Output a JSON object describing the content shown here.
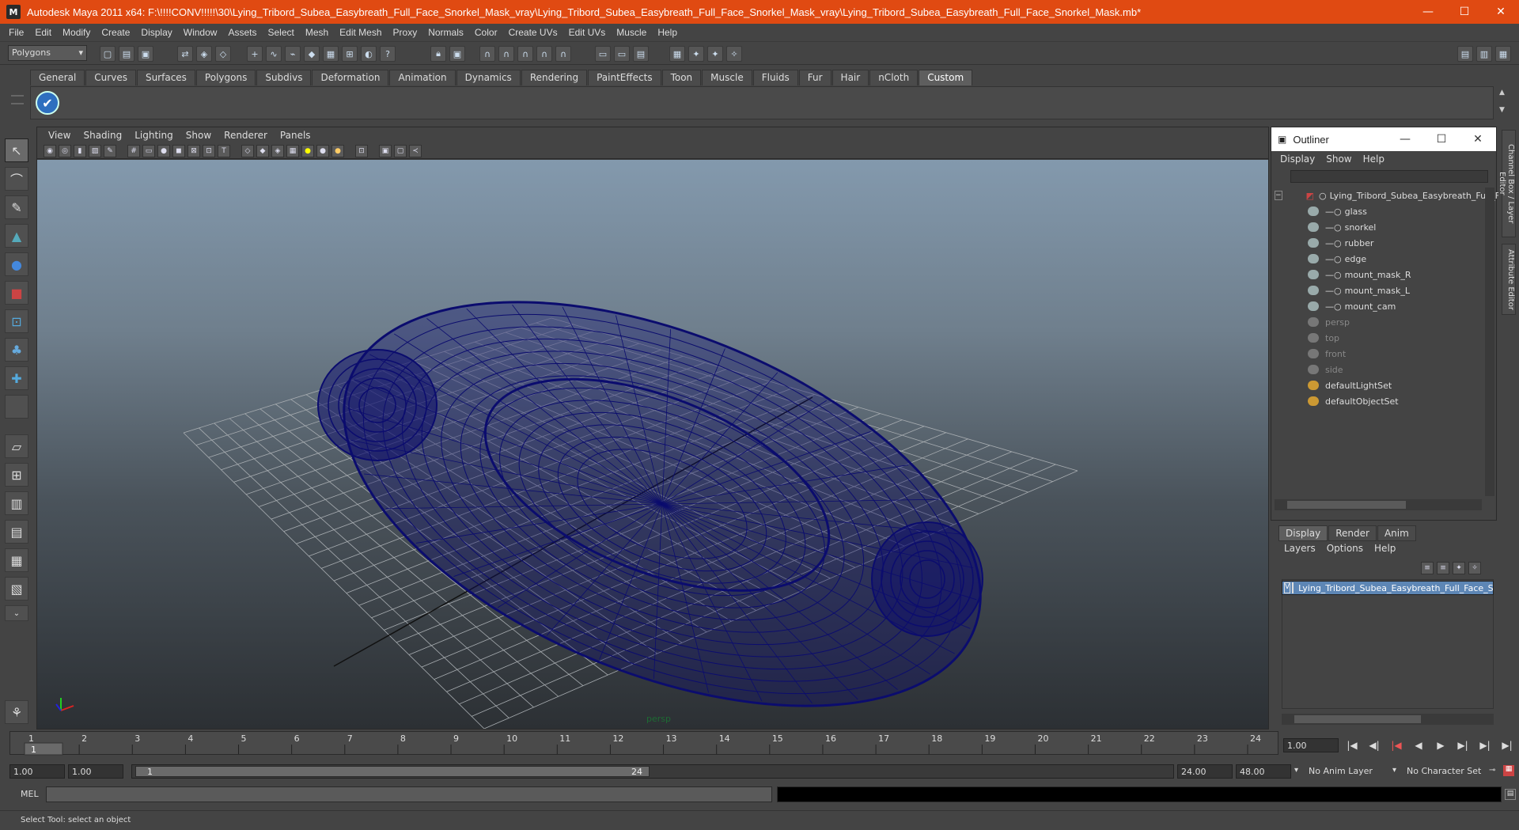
{
  "window": {
    "title": "Autodesk Maya 2011 x64: F:\\!!!!CONV!!!!!\\30\\Lying_Tribord_Subea_Easybreath_Full_Face_Snorkel_Mask_vray\\Lying_Tribord_Subea_Easybreath_Full_Face_Snorkel_Mask_vray\\Lying_Tribord_Subea_Easybreath_Full_Face_Snorkel_Mask.mb*",
    "minimize": "—",
    "maximize": "☐",
    "close": "✕"
  },
  "menubar": [
    "File",
    "Edit",
    "Modify",
    "Create",
    "Display",
    "Window",
    "Assets",
    "Select",
    "Mesh",
    "Edit Mesh",
    "Proxy",
    "Normals",
    "Color",
    "Create UVs",
    "Edit UVs",
    "Muscle",
    "Help"
  ],
  "statusline": {
    "mode": "Polygons"
  },
  "shelf": {
    "tabs": [
      "General",
      "Curves",
      "Surfaces",
      "Polygons",
      "Subdivs",
      "Deformation",
      "Animation",
      "Dynamics",
      "Rendering",
      "PaintEffects",
      "Toon",
      "Muscle",
      "Fluids",
      "Fur",
      "Hair",
      "nCloth",
      "Custom"
    ],
    "active_tab": "Custom"
  },
  "viewport": {
    "menu": [
      "View",
      "Shading",
      "Lighting",
      "Show",
      "Renderer",
      "Panels"
    ],
    "camera": "persp",
    "wire_color": "#0b0c6e"
  },
  "outliner": {
    "title": "Outliner",
    "menu": [
      "Display",
      "Show",
      "Help"
    ],
    "items": [
      {
        "label": "Lying_Tribord_Subea_Easybreath_Full_F",
        "dim": false
      },
      {
        "label": "glass",
        "dim": false
      },
      {
        "label": "snorkel",
        "dim": false
      },
      {
        "label": "rubber",
        "dim": false
      },
      {
        "label": "edge",
        "dim": false
      },
      {
        "label": "mount_mask_R",
        "dim": false
      },
      {
        "label": "mount_mask_L",
        "dim": false
      },
      {
        "label": "mount_cam",
        "dim": false
      },
      {
        "label": "persp",
        "dim": true
      },
      {
        "label": "top",
        "dim": true
      },
      {
        "label": "front",
        "dim": true
      },
      {
        "label": "side",
        "dim": true
      },
      {
        "label": "defaultLightSet",
        "dim": false
      },
      {
        "label": "defaultObjectSet",
        "dim": false
      }
    ]
  },
  "layer_editor": {
    "tabs": [
      "Display",
      "Render",
      "Anim"
    ],
    "menu": [
      "Layers",
      "Options",
      "Help"
    ],
    "layer_name": "Lying_Tribord_Subea_Easybreath_Full_Face_Sn",
    "layer_flag": "V"
  },
  "side_tabs": [
    "Channel Box / Layer Editor",
    "Attribute Editor"
  ],
  "timeline": {
    "ticks": [
      "1",
      "2",
      "3",
      "4",
      "5",
      "6",
      "7",
      "8",
      "9",
      "10",
      "11",
      "12",
      "13",
      "14",
      "15",
      "16",
      "17",
      "18",
      "19",
      "20",
      "21",
      "22",
      "23",
      "24"
    ],
    "current_frame_label": "1",
    "current_time": "1.00"
  },
  "range": {
    "start": "1.00",
    "playback_start": "1.00",
    "thumb_start": "1",
    "thumb_end": "24",
    "playback_end": "24.00",
    "end": "48.00",
    "anim_layer": "No Anim Layer",
    "char_set": "No Character Set"
  },
  "command": {
    "label": "MEL"
  },
  "help_line": "Select Tool: select an object"
}
